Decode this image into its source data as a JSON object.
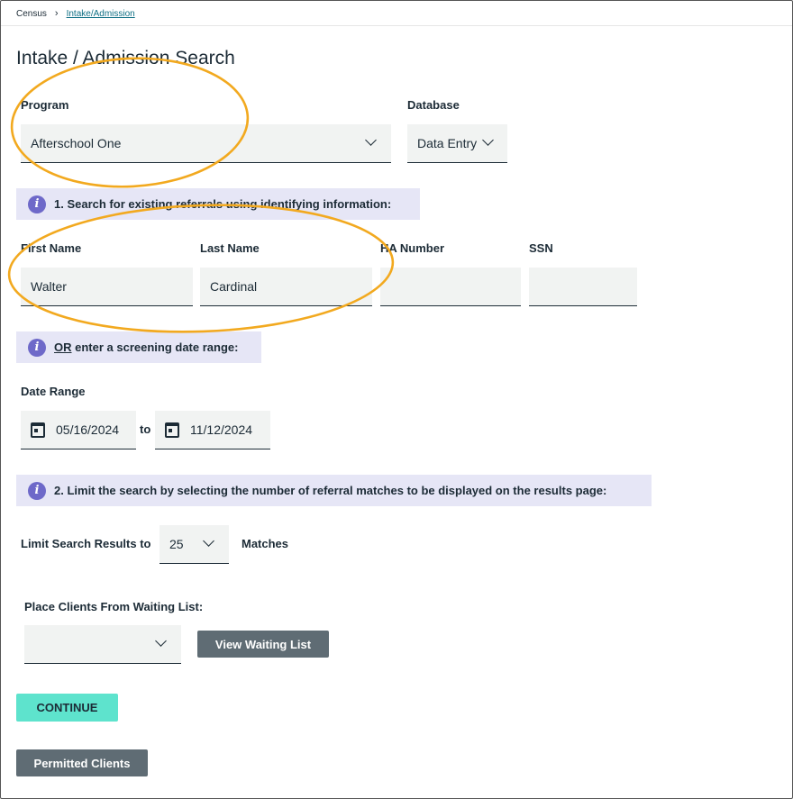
{
  "breadcrumb": {
    "root": "Census",
    "current": "Intake/Admission"
  },
  "page_title": "Intake / Admission Search",
  "program": {
    "label": "Program",
    "value": "Afterschool One"
  },
  "database": {
    "label": "Database",
    "value": "Data Entry"
  },
  "step1": {
    "text": "1. Search for existing referrals using identifying information:"
  },
  "first_name": {
    "label": "First Name",
    "value": "Walter"
  },
  "last_name": {
    "label": "Last Name",
    "value": "Cardinal"
  },
  "ha_number": {
    "label": "HA Number",
    "value": ""
  },
  "ssn": {
    "label": "SSN",
    "value": ""
  },
  "or_info": {
    "or": "OR",
    "rest": " enter a screening date range:"
  },
  "date_range": {
    "label": "Date Range",
    "from": "05/16/2024",
    "to_word": "to",
    "to": "11/12/2024"
  },
  "step2": {
    "text": "2. Limit the search by selecting the number of referral matches to be displayed on the results page:"
  },
  "limit": {
    "label": "Limit Search Results to",
    "value": "25",
    "suffix": "Matches"
  },
  "waiting": {
    "label": "Place Clients From Waiting List:",
    "value": "",
    "button": "View Waiting List"
  },
  "continue_button": "CONTINUE",
  "permitted_button": "Permitted Clients",
  "info_icon_glyph": "i",
  "colors": {
    "annotation": "#f2a91f",
    "teal_button": "#5ee3cd",
    "grey_button": "#5f6c74",
    "info_band": "#e6e6f6",
    "info_icon": "#6e69c9",
    "field_bg": "#f1f3f2"
  },
  "icons": [
    "chevron-right-icon",
    "chevron-down-icon",
    "info-icon",
    "calendar-icon"
  ]
}
